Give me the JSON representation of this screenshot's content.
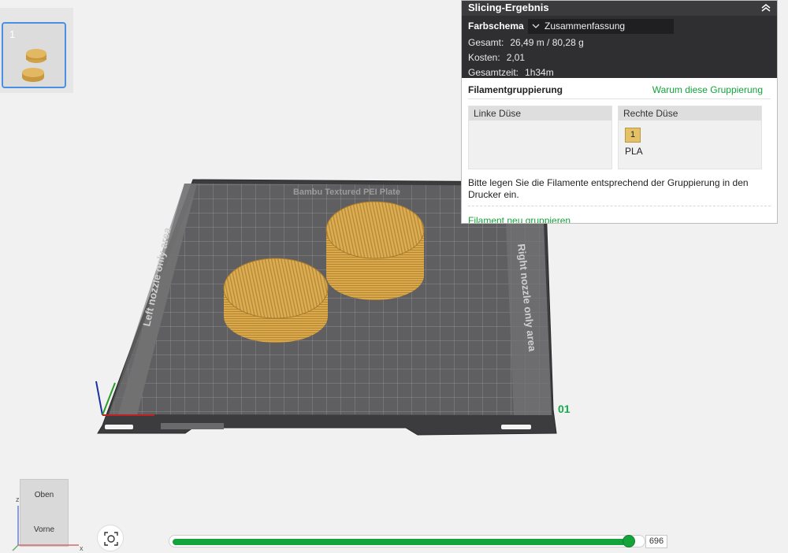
{
  "plate_list": {
    "items": [
      {
        "number": "1"
      }
    ]
  },
  "scene": {
    "bed_title": "Bambu Textured PEI Plate",
    "left_zone_label": "Left nozzle only area",
    "right_zone_label": "Right nozzle only area",
    "plate_index_label": "01"
  },
  "slicing_panel": {
    "title": "Slicing-Ergebnis",
    "color_scheme_label": "Farbschema",
    "color_scheme_value": "Zusammenfassung",
    "stats": [
      {
        "label": "Gesamt:",
        "value": "26,49 m / 80,28 g"
      },
      {
        "label": "Kosten:",
        "value": "2,01"
      },
      {
        "label": "Gesamtzeit:",
        "value": "1h34m"
      }
    ],
    "grouping": {
      "title": "Filamentgruppierung",
      "why_link": "Warum diese Gruppierung",
      "left_nozzle": {
        "label": "Linke Düse"
      },
      "right_nozzle": {
        "label": "Rechte Düse",
        "filament_number": "1",
        "filament_type": "PLA"
      },
      "hint": "Bitte legen Sie die Filamente entsprechend der Gruppierung in den Drucker ein.",
      "regroup_link": "Filament neu gruppieren"
    }
  },
  "view_cube": {
    "top_label": "Oben",
    "front_label": "Vorne"
  },
  "axis_labels": {
    "z": "z",
    "x": "x"
  },
  "layer_slider": {
    "value": "696",
    "fraction": 0.98
  },
  "colors": {
    "accent_green": "#15a33b",
    "filament_color": "#d6a64a",
    "panel_dark": "#2f2f31"
  }
}
